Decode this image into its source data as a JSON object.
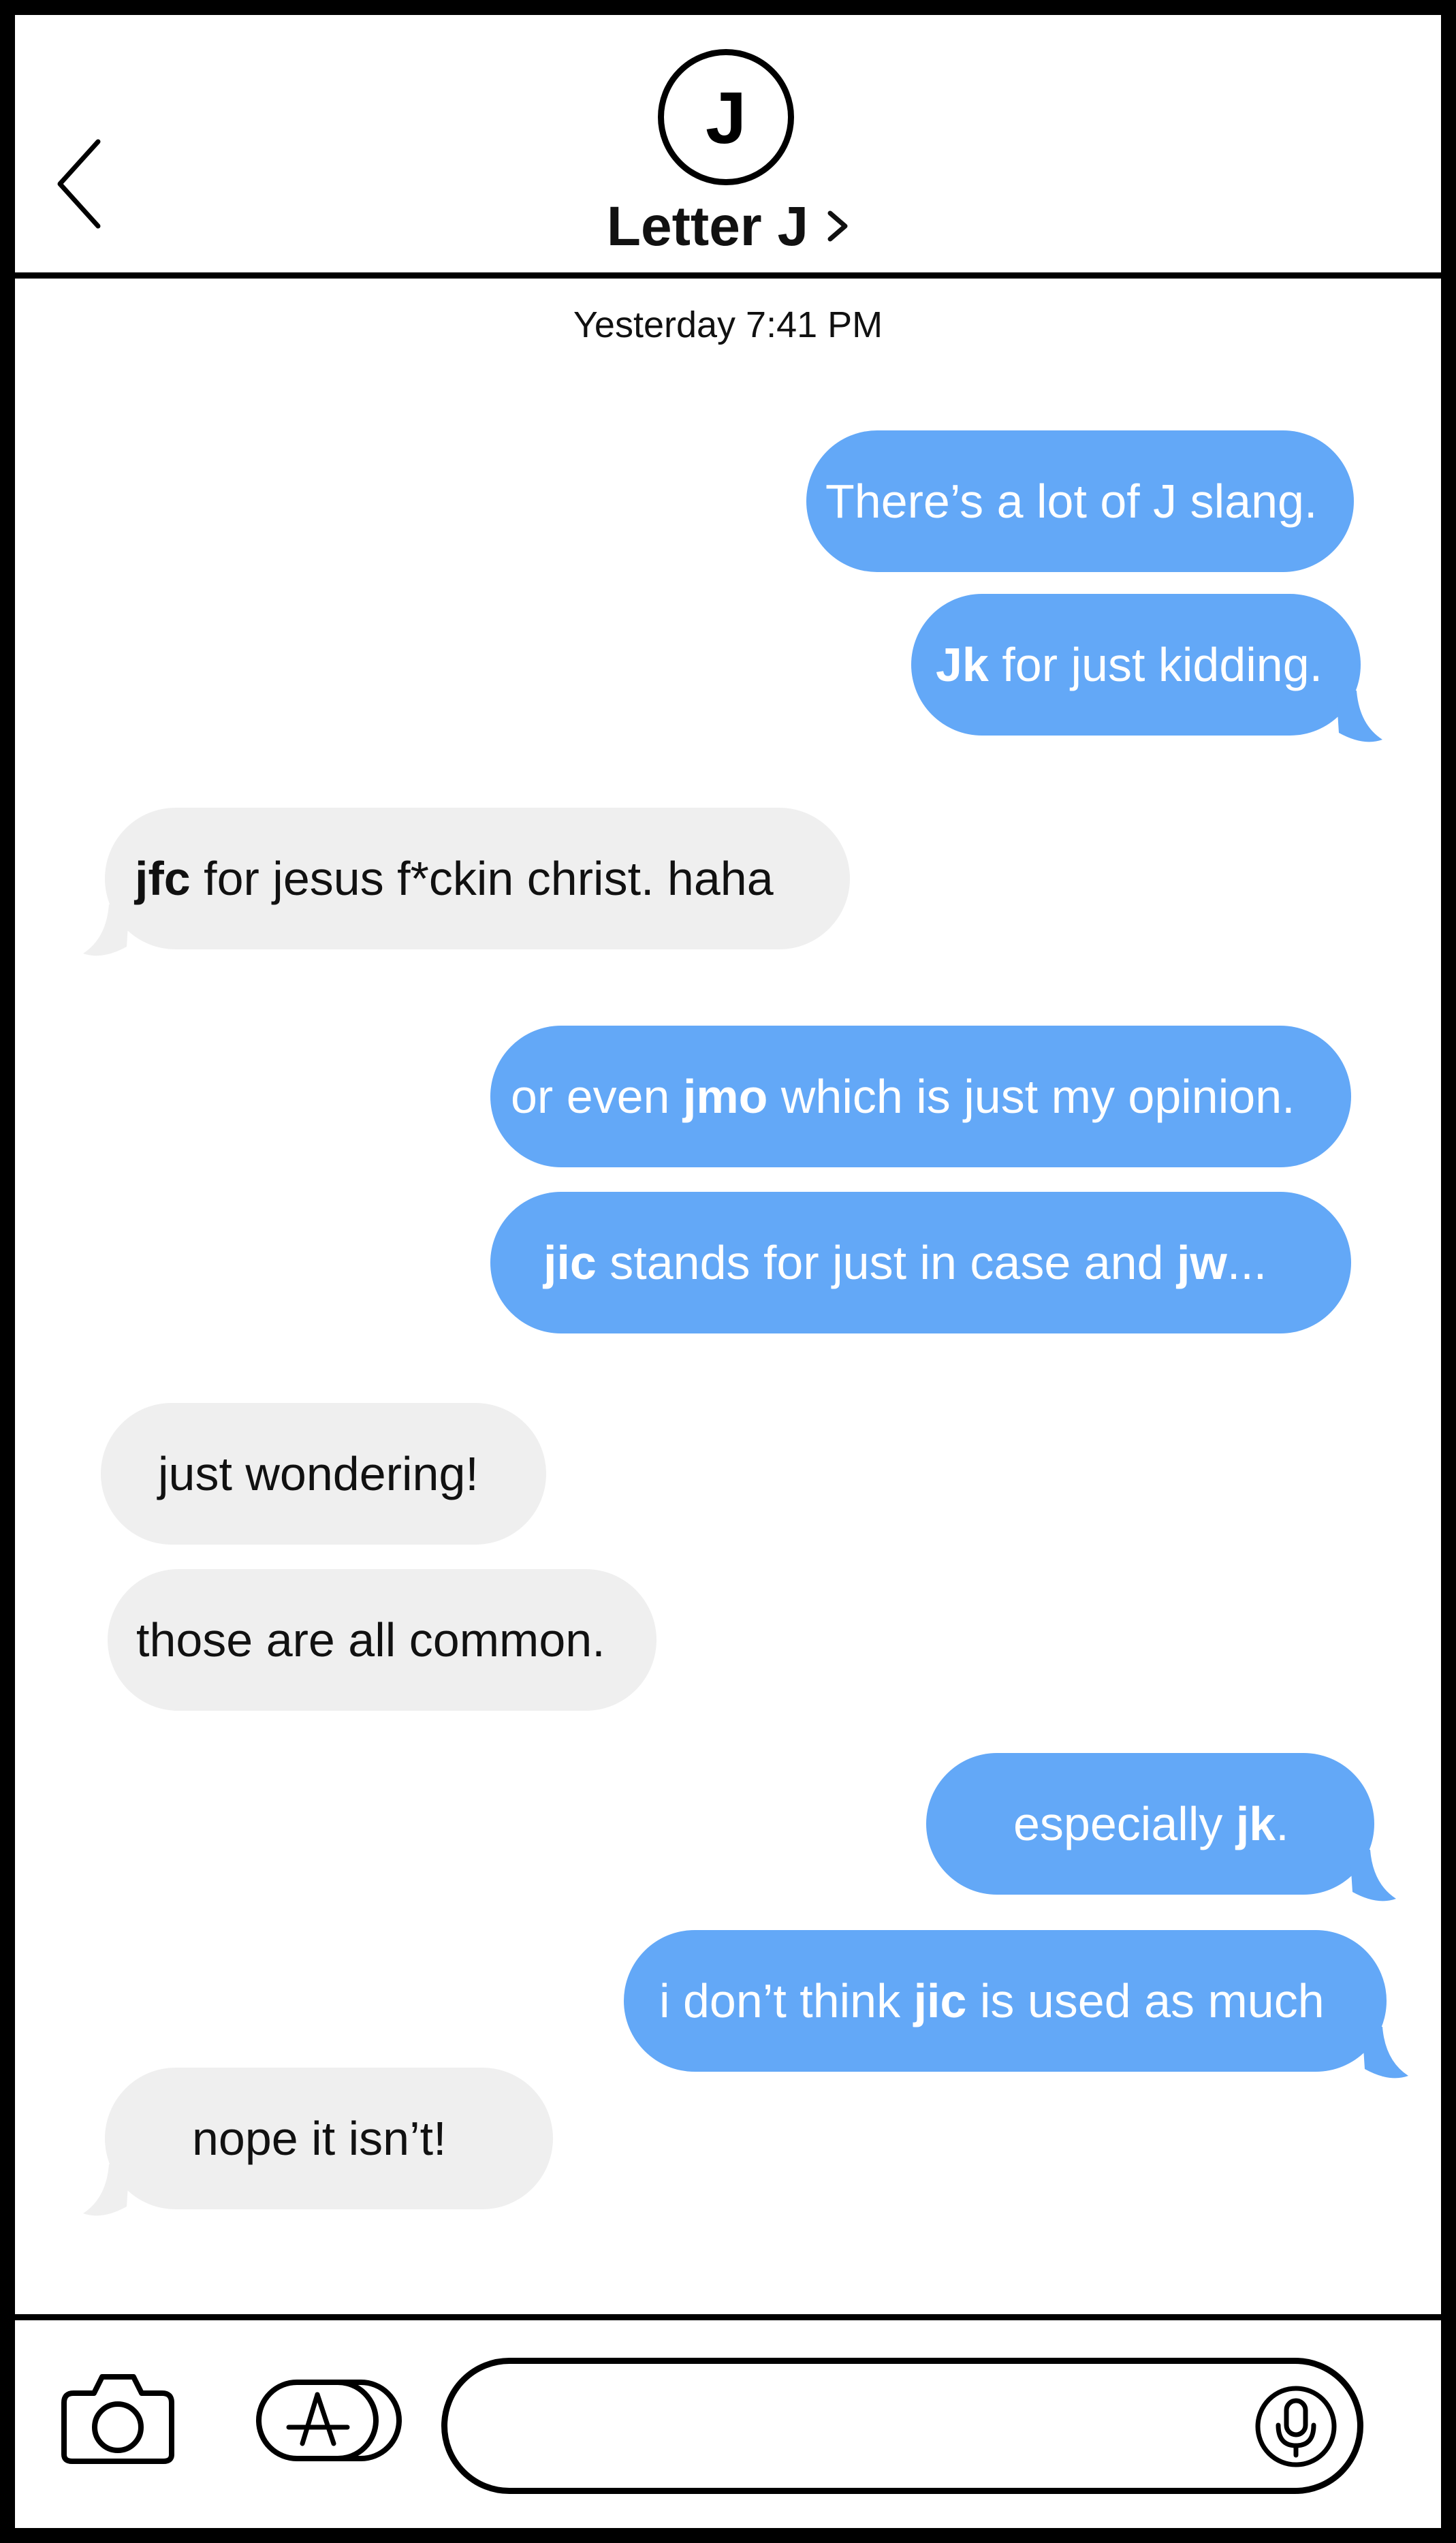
{
  "header": {
    "back_icon": "chevron-left-icon",
    "avatar_initial": "J",
    "contact_name": "Letter J",
    "contact_chevron_icon": "chevron-right-icon"
  },
  "timestamp": "Yesterday 7:41 PM",
  "messages": [
    {
      "from": "me",
      "parts": [
        {
          "t": "There’s a lot of J slang.",
          "b": false
        }
      ]
    },
    {
      "from": "me",
      "parts": [
        {
          "t": "Jk",
          "b": true
        },
        {
          "t": " for just kidding.",
          "b": false
        }
      ]
    },
    {
      "from": "them",
      "parts": [
        {
          "t": "jfc",
          "b": true
        },
        {
          "t": " for jesus f*ckin christ. haha",
          "b": false
        }
      ]
    },
    {
      "from": "me",
      "parts": [
        {
          "t": "or even ",
          "b": false
        },
        {
          "t": "jmo",
          "b": true
        },
        {
          "t": " which is just my opinion.",
          "b": false
        }
      ]
    },
    {
      "from": "me",
      "parts": [
        {
          "t": "jic",
          "b": true
        },
        {
          "t": " stands for just in case and ",
          "b": false
        },
        {
          "t": "jw",
          "b": true
        },
        {
          "t": "...",
          "b": false
        }
      ]
    },
    {
      "from": "them",
      "parts": [
        {
          "t": "just wondering!",
          "b": false
        }
      ]
    },
    {
      "from": "them",
      "parts": [
        {
          "t": "those are all common.",
          "b": false
        }
      ]
    },
    {
      "from": "me",
      "parts": [
        {
          "t": "especially ",
          "b": false
        },
        {
          "t": "jk",
          "b": true
        },
        {
          "t": ".",
          "b": false
        }
      ]
    },
    {
      "from": "me",
      "parts": [
        {
          "t": "i don’t think ",
          "b": false
        },
        {
          "t": "jic",
          "b": true
        },
        {
          "t": " is used as much",
          "b": false
        }
      ]
    },
    {
      "from": "them",
      "parts": [
        {
          "t": "nope it isn’t!",
          "b": false
        }
      ]
    }
  ],
  "toolbar": {
    "camera_icon": "camera-icon",
    "apps_icon": "app-store-icon",
    "message_input_value": "",
    "mic_icon": "microphone-icon"
  },
  "colors": {
    "outgoing_bubble": "#63a8f7",
    "incoming_bubble": "#efefef",
    "outgoing_text": "#ffffff",
    "incoming_text": "#111111"
  }
}
